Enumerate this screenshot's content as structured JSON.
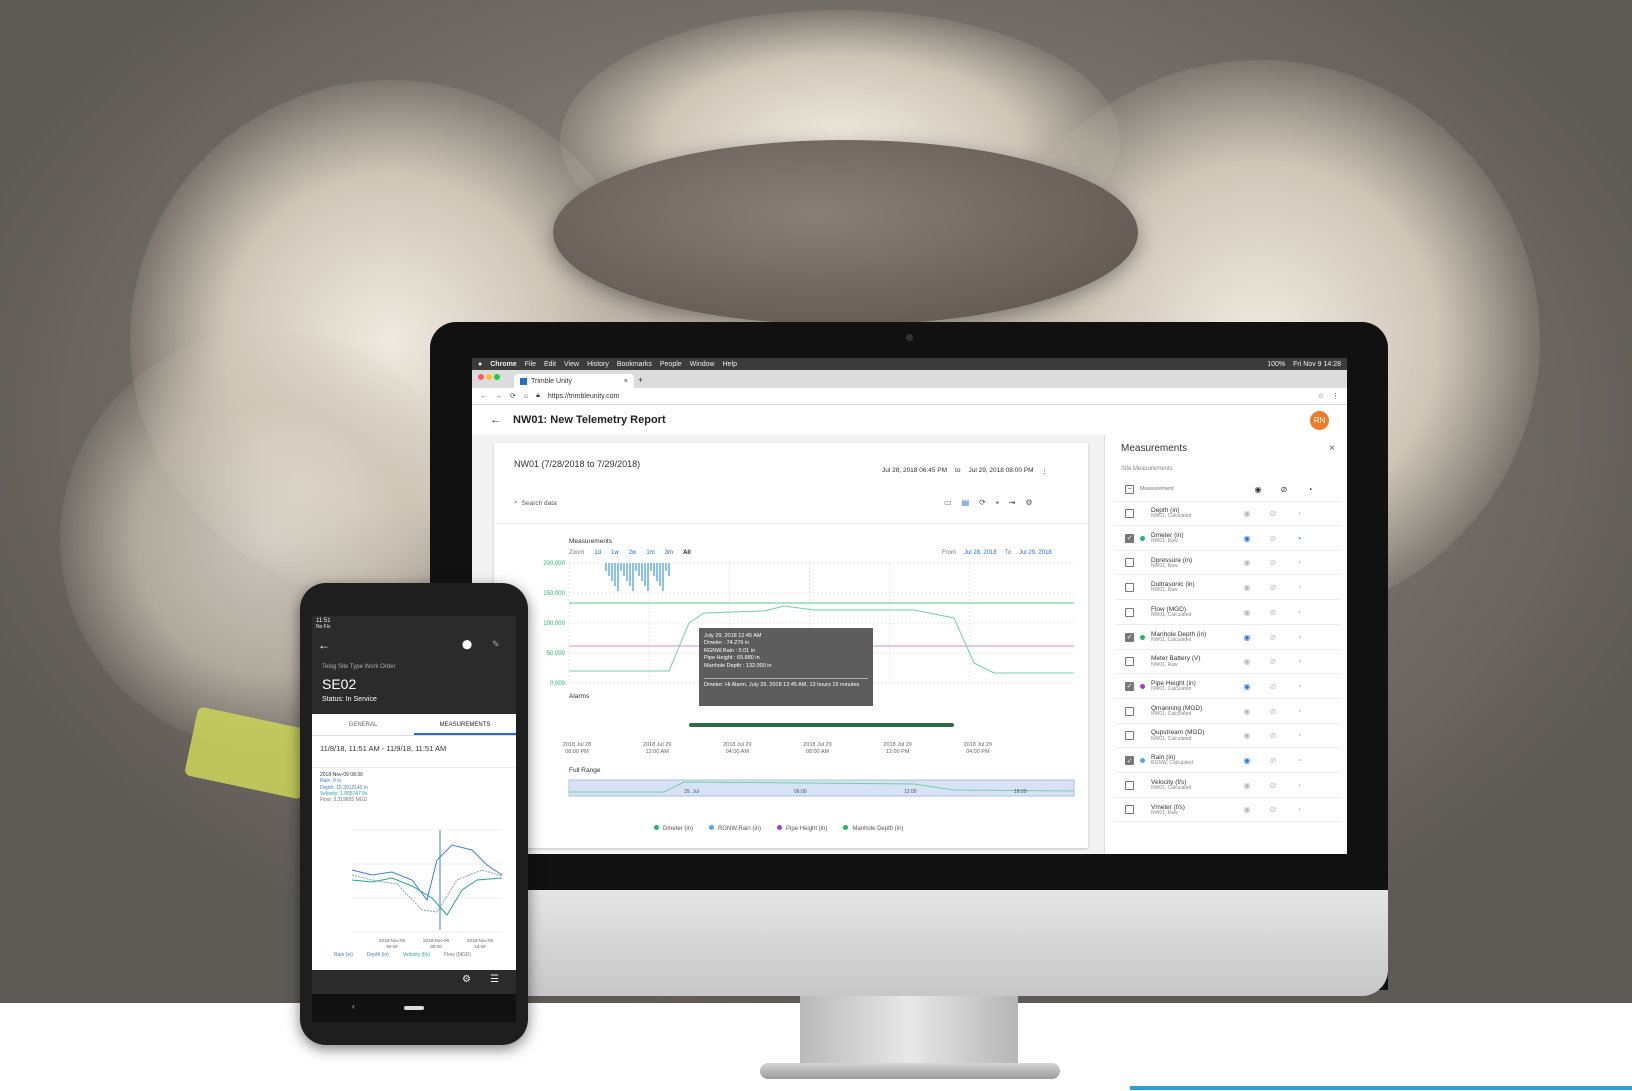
{
  "mac_menu": {
    "app": "Chrome",
    "items": [
      "File",
      "Edit",
      "View",
      "History",
      "Bookmarks",
      "People",
      "Window",
      "Help"
    ],
    "battery": "100%",
    "clock": "Fri Nov 9 14:28"
  },
  "browser": {
    "tab_title": "Trimble Unity",
    "url": "https://trimbleunity.com"
  },
  "app": {
    "title": "NW01: New Telemetry Report",
    "avatar": "RN"
  },
  "report": {
    "heading": "NW01 (7/28/2018 to 7/29/2018)",
    "date_from": "Jul 28, 2018 06:45 PM",
    "to_label": "to",
    "date_to": "Jul 29, 2018 08:00 PM",
    "search_placeholder": "Search data"
  },
  "chart": {
    "section_label": "Measurements",
    "zoom_label": "Zoom",
    "zoom_options": [
      "1d",
      "1w",
      "2w",
      "1m",
      "3m",
      "All"
    ],
    "from_label": "From",
    "from_date": "Jul 28, 2018",
    "to_label": "To",
    "to_date": "Jul 29, 2018",
    "y_ticks": [
      "200.000",
      "150.000",
      "100.000",
      "50.000",
      "0.000"
    ],
    "alarms_label": "Alarms",
    "full_range_label": "Full Range",
    "x_ticks": [
      "2018 Jul 28\n08:00 PM",
      "2018 Jul 29\n12:00 AM",
      "2018 Jul 29\n04:00 AM",
      "2018 Jul 29\n08:00 AM",
      "2018 Jul 29\n12:00 PM",
      "2018 Jul 29\n04:00 PM"
    ],
    "range_ticks": [
      "29. Jul",
      "06:00",
      "12:00",
      "18:00"
    ],
    "tooltip": {
      "time": "July 29, 2018 12:45 AM",
      "lines": [
        "Dmeter : 74.276 in",
        "RGNW.Rain : 0.01 in",
        "Pipe Height : 65.880 in",
        "Manhole Depth : 132.000 in"
      ],
      "alarm": "Dmeter: Hi Alarm, July 29, 2018 12:45 AM, 13 hours 15 minutes"
    },
    "legend": [
      "Dmeter (in)",
      "RGNW.Rain (in)",
      "Pipe Height (in)",
      "Manhole Depth (in)"
    ],
    "legend_colors": [
      "#27b36b",
      "#58a8e8",
      "#9b3fd1",
      "#27b36b"
    ]
  },
  "panel": {
    "title": "Measurements",
    "subtitle": "Site Measurements",
    "header": "Measurement",
    "rows": [
      {
        "name": "Depth (in)",
        "src": "NW01, Calculated",
        "checked": false,
        "color": "",
        "vis": false
      },
      {
        "name": "Dmeter (in)",
        "src": "NW01, Raw",
        "checked": true,
        "color": "#27b36b",
        "vis": true
      },
      {
        "name": "Dpressure (in)",
        "src": "NW01, Raw",
        "checked": false,
        "color": "",
        "vis": false
      },
      {
        "name": "Dultrasonic (in)",
        "src": "NW01, Raw",
        "checked": false,
        "color": "",
        "vis": false
      },
      {
        "name": "Flow (MGD)",
        "src": "NW01, Calculated",
        "checked": false,
        "color": "",
        "vis": false
      },
      {
        "name": "Manhole Depth (in)",
        "src": "NW01, Calculated",
        "checked": true,
        "color": "#27b36b",
        "vis": true
      },
      {
        "name": "Meter Battery (V)",
        "src": "NW01, Raw",
        "checked": false,
        "color": "",
        "vis": false
      },
      {
        "name": "Pipe Height (in)",
        "src": "NW01, Calculated",
        "checked": true,
        "color": "#9b3fd1",
        "vis": true
      },
      {
        "name": "Qmanning (MGD)",
        "src": "NW01, Calculated",
        "checked": false,
        "color": "",
        "vis": false
      },
      {
        "name": "Qupstream (MGD)",
        "src": "NW01, Calculated",
        "checked": false,
        "color": "",
        "vis": false
      },
      {
        "name": "Rain (in)",
        "src": "RGNW, Calculated",
        "checked": true,
        "color": "#58a8e8",
        "vis": true
      },
      {
        "name": "Velocity (f/s)",
        "src": "NW01, Calculated",
        "checked": false,
        "color": "",
        "vis": false
      },
      {
        "name": "Vmeter (f/s)",
        "src": "NW01, Raw",
        "checked": false,
        "color": "",
        "vis": false
      }
    ]
  },
  "phone": {
    "time": "11:51",
    "gps": "No Fix",
    "work_order": "Telog Site Type Work Order",
    "site": "SE02",
    "status": "Status: In Service",
    "tabs": [
      "GENERAL",
      "MEASUREMENTS"
    ],
    "range": "11/8/18, 11:51 AM - 11/9/18, 11:51 AM",
    "reading_time": "2018-Nov-09 08:30",
    "readings": [
      "Rain: 0 in",
      "Depth: 15.3012142 in",
      "Velocity: 1.905747 f/s",
      "Flow: 3.319855 MGD"
    ],
    "x_ticks": [
      "2018-Nov-09\n00:00",
      "2018-Nov-09\n08:00",
      "2018-Nov-09\n16:00"
    ],
    "legend": [
      "Rain (in)",
      "Depth (in)",
      "Velocity (f/s)",
      "Flow (MGD)"
    ]
  }
}
